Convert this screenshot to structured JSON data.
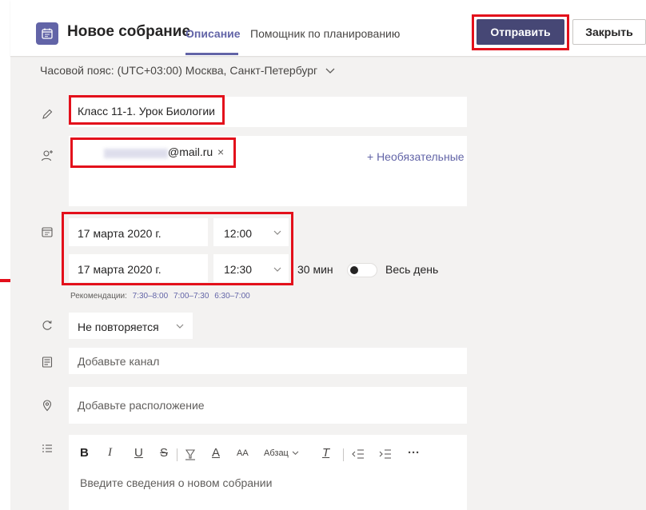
{
  "header": {
    "title": "Новое собрание",
    "tab_active": "Описание",
    "tab_scheduler": "Помощник по планированию",
    "send_label": "Отправить",
    "close_label": "Закрыть"
  },
  "timezone": {
    "label": "Часовой пояс: (UTC+03:00) Москва, Санкт-Петербург"
  },
  "meeting": {
    "title": "Класс 11-1. Урок Биологии",
    "attendee_email": "@mail.ru",
    "attendee_remove": "×",
    "optional_label": "+ Необязательные"
  },
  "datetime": {
    "start_date": "17 марта 2020 г.",
    "start_time": "12:00",
    "end_date": "17 марта 2020 г.",
    "end_time": "12:30",
    "duration": "30 мин",
    "all_day_label": "Весь день",
    "all_day_on": false
  },
  "suggestions": {
    "label": "Рекомендации:",
    "slots": [
      "7:30–8:00",
      "7:00–7:30",
      "6:30–7:00"
    ]
  },
  "repeat": {
    "value": "Не повторяется"
  },
  "channel": {
    "placeholder": "Добавьте канал"
  },
  "location": {
    "placeholder": "Добавьте расположение"
  },
  "editor": {
    "bold": "B",
    "italic": "I",
    "underline": "U",
    "strike": "S",
    "size": "A",
    "size_small": "AA",
    "paragraph": "Абзац",
    "clear_format": "T",
    "more": "···",
    "placeholder": "Введите сведения о новом собрании"
  },
  "colors": {
    "accent": "#6264a7",
    "send_bg": "#464775",
    "highlight": "#e3101b",
    "pane_bg": "#f3f2f1"
  }
}
